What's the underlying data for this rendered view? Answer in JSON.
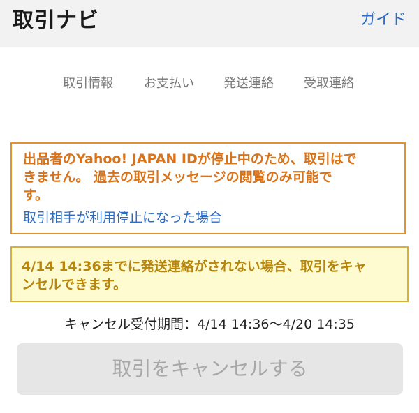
{
  "header": {
    "title": "取引ナビ",
    "guide_link": "ガイド"
  },
  "steps": [
    {
      "label": "取引情報"
    },
    {
      "label": "お支払い"
    },
    {
      "label": "発送連絡"
    },
    {
      "label": "受取連絡"
    }
  ],
  "alert": {
    "message_line1": "出品者のYahoo! JAPAN IDが停止中のため、取引はで",
    "message_line2": "きません。 過去の取引メッセージの閲覧のみ可能で",
    "message_line3": "す。",
    "link": "取引相手が利用停止になった場合"
  },
  "notice": {
    "message_line1": "4/14 14:36までに発送連絡がされない場合、取引をキャ",
    "message_line2": "ンセルできます。"
  },
  "cancel_period": "キャンセル受付期間：4/14 14:36〜4/20 14:35",
  "cancel_button": "取引をキャンセルする",
  "colors": {
    "link_blue": "#2d6cc4",
    "alert_orange": "#d9731a",
    "notice_yellow_bg": "#fffbd1",
    "notice_text": "#b8860b",
    "disabled_button_bg": "#e6e6e6"
  }
}
